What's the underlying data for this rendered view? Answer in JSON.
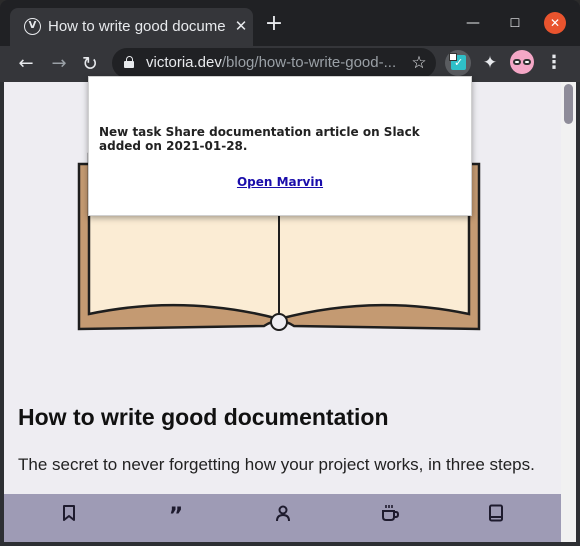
{
  "tab": {
    "title": "How to write good documentation",
    "favicon_letter": "V"
  },
  "toolbar": {
    "url_host": "victoria.dev",
    "url_path": "/blog/how-to-write-good-..."
  },
  "icons": {
    "back": "back-arrow-icon",
    "forward": "forward-arrow-icon",
    "reload": "reload-icon",
    "star": "bookmark-star-icon",
    "marvin": "marvin-extension-icon",
    "puzzle": "extensions-puzzle-icon",
    "menu": "kebab-menu-icon"
  },
  "popup": {
    "message": "New task Share documentation article on Slack added on 2021-01-28.",
    "link": "Open Marvin"
  },
  "article": {
    "title": "How to write good documentation",
    "subtitle": "The secret to never forgetting how your project works, in three steps."
  },
  "bottom_nav": {
    "items": [
      "bookmark-icon",
      "quote-icon",
      "person-icon",
      "coffee-icon",
      "book-icon"
    ]
  },
  "colors": {
    "chrome_dark": "#202124",
    "page_bg": "#eeedf2",
    "bottom_nav": "#9e9bb5",
    "close_button": "#e9542e",
    "book_blue": "#4a7be8"
  }
}
